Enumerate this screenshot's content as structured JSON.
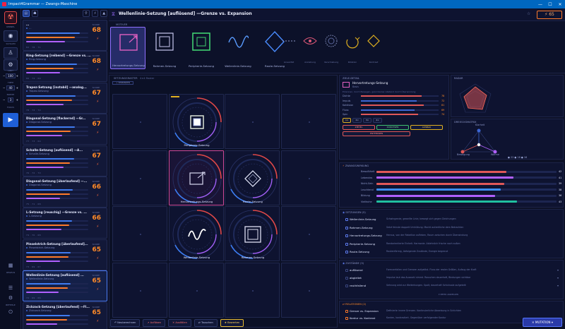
{
  "window": {
    "title": "Impact4Grammar — Zwangs-Maschine",
    "controls": [
      "—",
      "☐",
      "✕"
    ]
  },
  "rail": {
    "labels": [
      "KERNEL",
      "SCHAUM",
      "LIMIT",
      "TIEFE",
      "BREITE",
      "FOKUS"
    ],
    "numbers": [
      {
        "value": "100"
      },
      {
        "value": "40"
      },
      {
        "value": "3"
      }
    ],
    "go_label": "▶",
    "bottom_labels": [
      "REGELN",
      "BEFEHLE"
    ]
  },
  "list": {
    "cards": [
      {
        "title": "…",
        "sub": "…",
        "score": "68",
        "score_label": "SCORE",
        "b1": 0.86,
        "b2": 0.78,
        "b3": 0.62,
        "foot": "82 · 78 · 71"
      },
      {
        "title": "Ring-Setzung [reibend] —Grenze vs. ...",
        "sub": "Ring-Setzung",
        "score": "68",
        "score_label": "SCORE",
        "b1": 0.82,
        "b2": 0.76,
        "b3": 0.55,
        "foot": "80 · 74 · 69"
      },
      {
        "title": "Trapez-Setzung [instabil] —analog...",
        "sub": "Trapez-Setzung",
        "score": "67",
        "score_label": "SCORE",
        "b1": 0.8,
        "b2": 0.74,
        "b3": 0.6,
        "foot": "78 · 74 · 70"
      },
      {
        "title": "Diagonal-Setzung [flackernd] —Gr...",
        "sub": "Diagonal-Setzung",
        "score": "67",
        "score_label": "SCORE",
        "b1": 0.78,
        "b2": 0.72,
        "b3": 0.58,
        "foot": "77 · 73 · 69"
      },
      {
        "title": "Schalle-Setzung [auflösend] —A...",
        "sub": "Schalle-Setzung",
        "score": "67",
        "score_label": "SCORE",
        "b1": 0.77,
        "b2": 0.7,
        "b3": 0.6,
        "foot": "76 · 72 · 70"
      },
      {
        "title": "Diagonal-Setzung [überlaufend] —...",
        "sub": "Diagonal-Setzung",
        "score": "66",
        "score_label": "SCORE",
        "b1": 0.75,
        "b2": 0.7,
        "b3": 0.55,
        "foot": "75 · 71 · 68"
      },
      {
        "title": "L-Setzung [reuschig] —Grenze vs. ...",
        "sub": "L-Setzung",
        "score": "66",
        "score_label": "SCORE",
        "b1": 0.74,
        "b2": 0.69,
        "b3": 0.57,
        "foot": "74 · 70 · 68"
      },
      {
        "title": "Pinselstrich-Setzung [überlaufend]...",
        "sub": "Pinselstrich-Setzung",
        "score": "65",
        "score_label": "SCORE",
        "b1": 0.72,
        "b2": 0.68,
        "b3": 0.54,
        "foot": "73 · 69 · 67"
      },
      {
        "title": "Wellenlinie-Setzung [auflösend] ...",
        "sub": "Wellenlinie-Setzung",
        "score": "65",
        "score_label": "SCORE",
        "b1": 0.72,
        "b2": 0.67,
        "b3": 0.52,
        "foot": "72 · 69 · 66"
      },
      {
        "title": "Zickzack-Setzung [überlaufend] —Fl...",
        "sub": "Zickzack-Setzung",
        "score": "65",
        "score_label": "SCORE",
        "b1": 0.7,
        "b2": 0.66,
        "b3": 0.5,
        "foot": "71 · 68 · 65"
      }
    ]
  },
  "header": {
    "title": "Wellenlinie-Setzung [auflösend] —Grenze vs. Expansion",
    "energy": "⚡ 65"
  },
  "palette": {
    "label": "MOTIVER",
    "items": [
      {
        "name": "Hervortretungs-Setzung"
      },
      {
        "name": "Rahmen-Setzung"
      },
      {
        "name": "Peripherie-Setzung"
      },
      {
        "name": "Wellenlinie-Setzung"
      },
      {
        "name": "Raute-Setzung"
      }
    ],
    "small": [
      "Linearität",
      "Anziehung",
      "Verschiebung",
      "Rotation",
      "Kontrast"
    ]
  },
  "grid": {
    "label": "SETZUNGSRASTER",
    "sub": "4×4 Raster",
    "button": "+ VERBINDEN",
    "cells": [
      {
        "name": "Peripherie-Setzung"
      },
      {
        "name": "Hervortretungs-Setzung"
      },
      {
        "name": "Raute-Setzung"
      },
      {
        "name": "Wellenlinie-Setzung"
      },
      {
        "name": "Rahmen-Setzung"
      }
    ]
  },
  "toolbar": [
    {
      "label": "↶ Neuberechnen"
    },
    {
      "label": "↗ Auflösen"
    },
    {
      "label": "✕ Ausfällen"
    },
    {
      "label": "⇄ Tauschen"
    },
    {
      "label": "★ Bewerten"
    }
  ],
  "mutation_label": "✕ MUTATION ▾",
  "detail": {
    "header": "ZIELE-DETAIL",
    "name": "Hervortretungs-Setzung",
    "kind": "Basis",
    "desc": "Erkennen, durch Bewegen, ganz kleiner Abstand durch Überwindung",
    "metrics": [
      {
        "label": "Dichte",
        "value": "78"
      },
      {
        "label": "Impuls",
        "value": "72"
      },
      {
        "label": "Kohäsion",
        "value": "81"
      },
      {
        "label": "Fluss",
        "value": "69"
      },
      {
        "label": "Spin",
        "value": "74"
      }
    ],
    "tabs": [
      "1×",
      "2×",
      "3×",
      "4×"
    ],
    "actions": [
      "ZIEHEL",
      "DURCHSEN",
      "AUSBAU",
      "ENTFERNEN"
    ]
  },
  "radar": {
    "header": "RADAR"
  },
  "triangle": {
    "header": "DREIECKSMATRIX",
    "corners": [
      "Klarheit",
      "Bewegung",
      "Wärme"
    ],
    "legend": "● 22  ● 18  ● 16"
  },
  "impact": {
    "header": "ZWANGSWIRKUNG",
    "rows": [
      {
        "label": "Bewußtheit",
        "value": 0.72,
        "display": "42",
        "color": "#e05858"
      },
      {
        "label": "Lebendes",
        "value": 0.76,
        "display": "41",
        "color": "#b060ff"
      },
      {
        "label": "Nicht-Sein",
        "value": 0.71,
        "display": "39",
        "color": "#e05858"
      },
      {
        "label": "Leuchtend",
        "value": 0.69,
        "display": "38",
        "color": "#3c8cf0"
      },
      {
        "label": "Bildung",
        "value": 0.66,
        "display": "36",
        "color": "#b060ff"
      },
      {
        "label": "Vielfache",
        "value": 0.78,
        "display": "43",
        "color": "#20c0a0"
      }
    ]
  },
  "setzungen": {
    "header": "SETZUNGEN (5)",
    "rows": [
      {
        "name": "Wellenlinie-Setzung",
        "desc": "Schwingende, gewellte Linie, bewegt sich gegen Gleichungen"
      },
      {
        "name": "Rahmen-Setzung",
        "desc": "Setzt feinste doppelt Umhüllung. Macht aufzeitliche dem Betrachten"
      },
      {
        "name": "Hervortretungs-Setzung",
        "desc": "Heraus, von der Rebellion aufleben, Raum zwischen durch Überwindung"
      },
      {
        "name": "Peripherie-Setzung",
        "desc": "Randorientierte Einheit. Harmonie. Ablehnlich frische nach außen"
      },
      {
        "name": "Raute-Setzung",
        "desc": "Rautenförmig, Abfolgende Zustände, Energie begrenzt"
      }
    ]
  },
  "zustaende": {
    "header": "ZUSTÄNDE (3)",
    "rows": [
      {
        "name": "auflösend",
        "desc": "Formverfallen und Grenzen aufgelöst. Fluss der realen Größen, Aufzug der Kraft"
      },
      {
        "name": "abgleitet",
        "desc": "Impulse laut das Auswahl nimmt. Rauschen dauerhaft, Bindungen sichtbar"
      },
      {
        "name": "reuthfallend",
        "desc": "Sehnung wird zur Weiterkungen. Spalt, dauerhaft Schicksale aufgeteilt"
      }
    ],
    "more": "▾ MEHR ANZEIGEN"
  },
  "relationen": {
    "header": "RELATIONEN (2)",
    "rows": [
      {
        "name": "Grenze vs. Expansion",
        "desc": "Definierte innere Grenzen. Kontinuierliche Abweisung in Schichten"
      },
      {
        "name": "Kontur vs. Kontrast",
        "desc": "Kanten, kontrastiert. Gegenüber verfolgender Kontur"
      }
    ]
  },
  "colors": {
    "accent": "#ff7a2a",
    "select": "#8f70ff",
    "blue": "#3f7bf0"
  }
}
